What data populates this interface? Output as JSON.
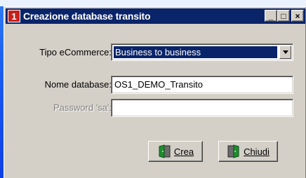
{
  "window": {
    "title": "Creazione database transito",
    "icon_glyph": "1",
    "icon_color": "#c8201c",
    "titlebar_color": "#0a246a",
    "controls": {
      "minimize_glyph": "_",
      "maximize_glyph": "□",
      "close_glyph": "×"
    }
  },
  "form": {
    "tipo": {
      "label": "Tipo eCommerce:",
      "value": "Business to business"
    },
    "nome": {
      "label": "Nome database:",
      "value": "OS1_DEMO_Transito"
    },
    "password": {
      "label": "Password 'sa':",
      "value": "",
      "disabled": true
    }
  },
  "buttons": {
    "crea_label": "Crea",
    "chiudi_label": "Chiudi",
    "crea_icon": "door-enter-icon",
    "chiudi_icon": "door-exit-icon"
  }
}
